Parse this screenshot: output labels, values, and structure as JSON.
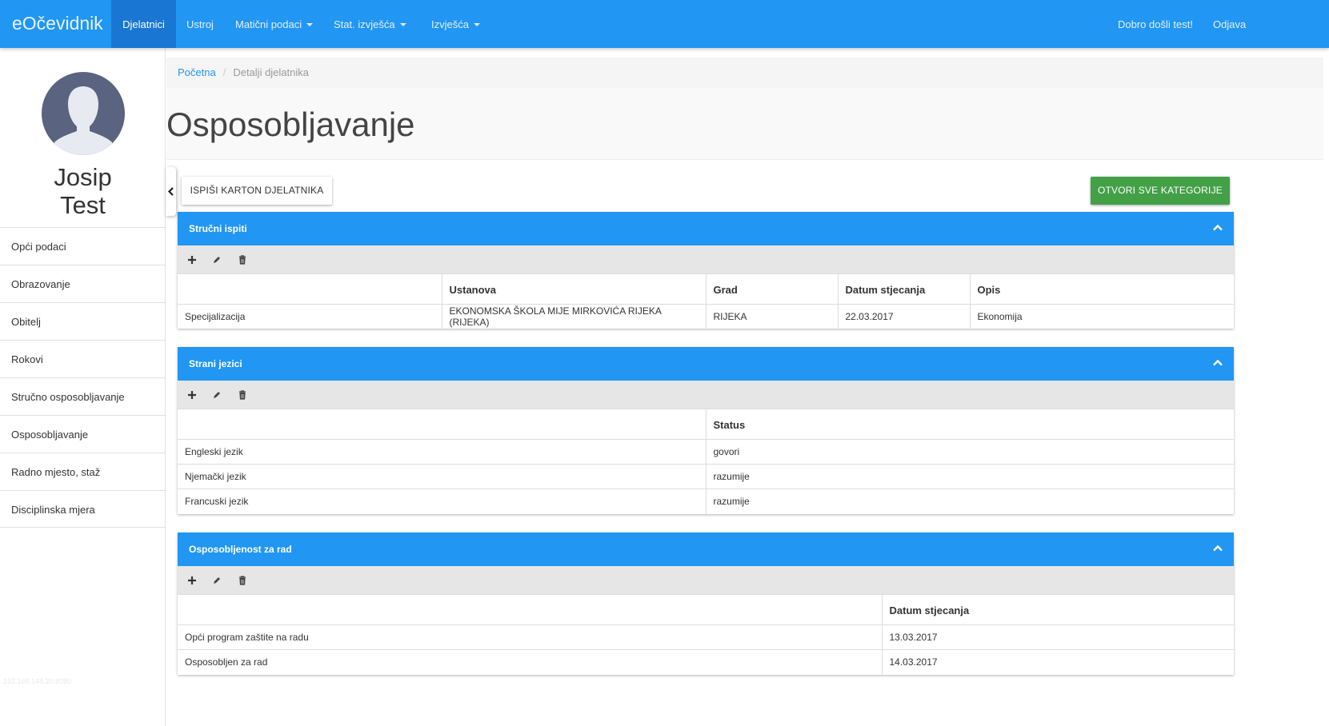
{
  "navbar": {
    "brand": "eOčevidnik",
    "items": [
      {
        "label": "Djelatnici",
        "active": true
      },
      {
        "label": "Ustroj"
      },
      {
        "label": "Matični podaci",
        "dropdown": true
      },
      {
        "label": "Stat. izvješća",
        "dropdown": true
      },
      {
        "label": "Izvješća",
        "dropdown": true
      }
    ],
    "welcome": "Dobro došli test!",
    "logout": "Odjava"
  },
  "profile": {
    "first_name": "Josip",
    "last_name": "Test"
  },
  "sidebar": {
    "items": [
      {
        "label": "Opći podaci"
      },
      {
        "label": "Obrazovanje"
      },
      {
        "label": "Obitelj"
      },
      {
        "label": "Rokovi"
      },
      {
        "label": "Stručno osposobljavanje"
      },
      {
        "label": "Osposobljavanje"
      },
      {
        "label": "Radno mjesto, staž"
      },
      {
        "label": "Disciplinska mjera"
      }
    ],
    "footer_ip": "192.168.144.20:8080"
  },
  "breadcrumb": {
    "home": "Početna",
    "separator": "/",
    "current": "Detalji djelatnika"
  },
  "page": {
    "title": "Osposobljavanje",
    "print_button": "ISPIŠI KARTON DJELATNIKA",
    "open_all_button": "OTVORI SVE KATEGORIJE"
  },
  "panels": {
    "exams": {
      "title": "Stručni ispiti",
      "headers": [
        "",
        "Ustanova",
        "Grad",
        "Datum stjecanja",
        "Opis"
      ],
      "rows": [
        [
          "Specijalizacija",
          "EKONOMSKA ŠKOLA MIJE MIRKOVIĆA RIJEKA (RIJEKA)",
          "RIJEKA",
          "22.03.2017",
          "Ekonomija"
        ]
      ]
    },
    "languages": {
      "title": "Strani jezici",
      "headers": [
        "",
        "Status"
      ],
      "rows": [
        [
          "Engleski jezik",
          "govori"
        ],
        [
          "Njemački jezik",
          "razumije"
        ],
        [
          "Francuski jezik",
          "razumije"
        ]
      ]
    },
    "work": {
      "title": "Osposobljenost za rad",
      "headers": [
        "",
        "Datum stjecanja"
      ],
      "rows": [
        [
          "Opći program zaštite na radu",
          "13.03.2017"
        ],
        [
          "Osposobljen za rad",
          "14.03.2017"
        ]
      ]
    }
  },
  "colors": {
    "primary": "#2196f3",
    "success": "#43a047",
    "avatar_bg": "#5a6380"
  },
  "icons": [
    "chevron-left-icon",
    "chevron-up-icon",
    "plus-icon",
    "pencil-icon",
    "trash-icon",
    "user-silhouette-icon"
  ]
}
